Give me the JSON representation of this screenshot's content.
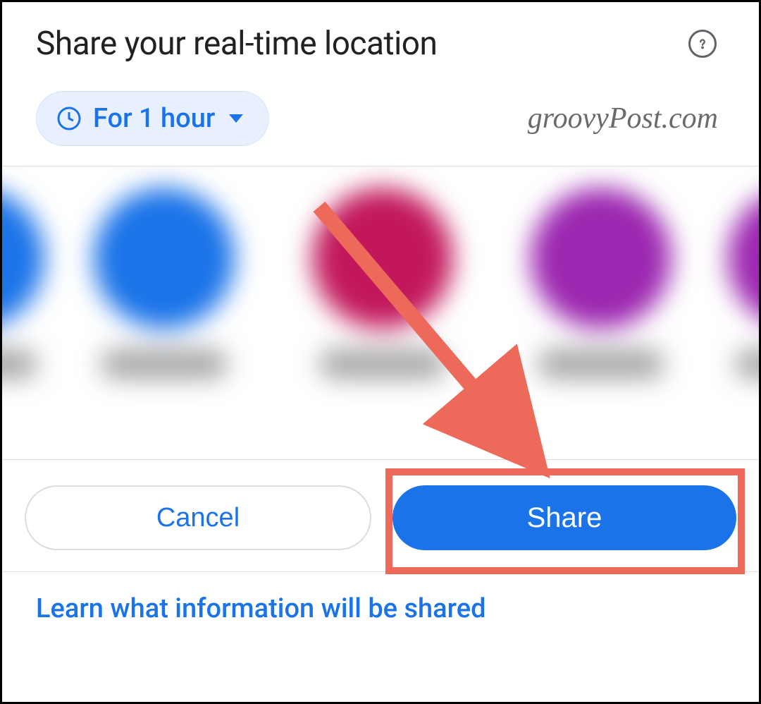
{
  "header": {
    "title": "Share your real-time location",
    "help_icon": "help-circle-icon"
  },
  "duration": {
    "chip_label": "For 1 hour",
    "icon": "clock-icon"
  },
  "watermark": "groovyPost.com",
  "contacts": [
    {
      "color": "#1a73e8"
    },
    {
      "color": "#1a73e8"
    },
    {
      "color": "#c2185b"
    },
    {
      "color": "#9c27b0"
    },
    {
      "color": "#9c27b0"
    }
  ],
  "buttons": {
    "cancel_label": "Cancel",
    "share_label": "Share"
  },
  "info": {
    "link_label": "Learn what information will be shared"
  },
  "annotation": {
    "arrow_color": "#ed6a5a",
    "highlight_color": "#ed6a5a"
  }
}
